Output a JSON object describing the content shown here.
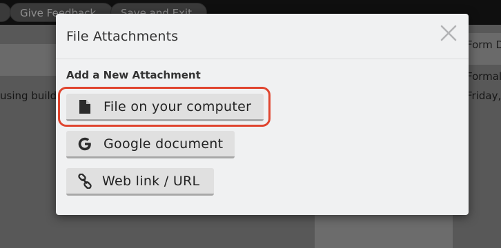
{
  "topbar": {
    "feedback_label": "Give Feedback",
    "save_exit_label": "Save and Exit"
  },
  "background": {
    "left_text": "using build",
    "right_header": "Form D",
    "right_line1": "Formal",
    "right_line2": "Friday,"
  },
  "modal": {
    "title": "File Attachments",
    "close_icon": "close-icon",
    "section_label": "Add a New Attachment",
    "buttons": [
      {
        "label": "File on your computer",
        "icon": "file-icon"
      },
      {
        "label": "Google document",
        "icon": "google-g-icon"
      },
      {
        "label": "Web link / URL",
        "icon": "link-icon"
      }
    ]
  },
  "colors": {
    "highlight": "#e0452f",
    "modal_bg": "#f0f1f2",
    "button_bg": "#e0e0e0"
  }
}
